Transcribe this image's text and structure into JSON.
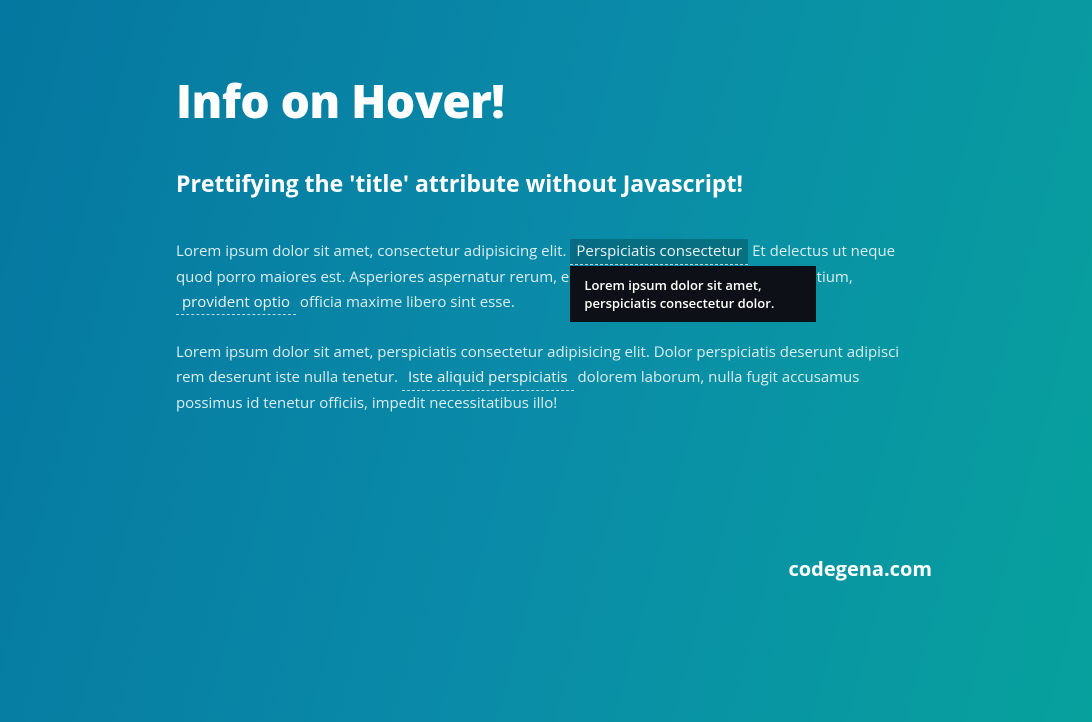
{
  "header": {
    "title": "Info on Hover!",
    "subtitle": "Prettifying the 'title' attribute without Javascript!"
  },
  "paragraphs": {
    "p1": {
      "seg1": "Lorem ipsum dolor sit amet, consectetur adipisicing elit. ",
      "tip1": "Perspiciatis consectetur",
      "seg2": " Et delectus ut neque quod porro maiores est. Asperiores aspernatur rerum, explicabo ipsa consequatur, accusantium, ",
      "tip2": "provident optio",
      "seg3": " officia maxime libero sint esse."
    },
    "p2": {
      "seg1": "Lorem ipsum dolor sit amet, perspiciatis consectetur adipisicing elit. Dolor perspiciatis deserunt adipisci rem deserunt iste nulla tenetur. ",
      "tip1": "Iste aliquid perspiciatis",
      "seg2": " dolorem laborum, nulla fugit accusamus possimus id tenetur officiis, impedit necessitatibus illo!"
    }
  },
  "tooltip": {
    "text": "Lorem ipsum dolor sit amet, perspiciatis consectetur dolor."
  },
  "attribution": "codegena.com"
}
